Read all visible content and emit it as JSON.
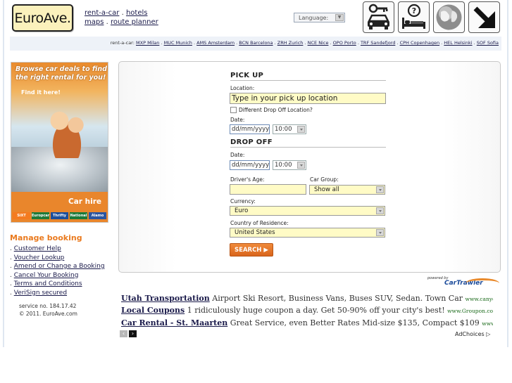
{
  "header": {
    "logo_text": "EuroAve.",
    "links_line1": [
      "rent-a-car",
      "hotels"
    ],
    "links_line2": [
      "maps",
      "route planner"
    ],
    "language_label": "Language:",
    "icons": [
      "car-key-icon",
      "hotel-bed-icon",
      "globe-icon",
      "arrow-down-right-icon"
    ]
  },
  "citybar": {
    "prefix": "rent-a-car:",
    "cities": [
      "MXP Milan",
      "MUC Munich",
      "AMS Amsterdam",
      "BCN Barcelona",
      "ZRH Zurich",
      "NCE Nice",
      "OPO Porto",
      "TRF Sandefjord",
      "CPH Copenhagen",
      "HEL Helsinki",
      "SOF Sofia"
    ]
  },
  "ad": {
    "title_line1": "Browse car deals to find",
    "title_line2": "the right rental for you!",
    "find_it": "Find it here!",
    "car_hire": "Car hire",
    "brands": [
      "SiXT",
      "Europcar",
      "Thrifty",
      "National",
      "Alamo"
    ],
    "brand_colors": [
      "#f47b20",
      "#1f7a3a",
      "#1c4f9c",
      "#1a7a3a",
      "#2a55a0"
    ]
  },
  "manage": {
    "title": "Manage booking",
    "links": [
      "Customer Help",
      "Voucher Lookup",
      "Amend or Change a Booking",
      "Cancel Your Booking",
      "Terms and Conditions",
      "VeriSign secured"
    ]
  },
  "service": {
    "line1": "service no. 184.17.42",
    "line2": "© 2011. EuroAve.com"
  },
  "form": {
    "pickup_title": "PICK UP",
    "location_label": "Location:",
    "location_placeholder": "Type in your pick up location",
    "diff_dropoff_label": "Different Drop Off Location?",
    "date_label": "Date:",
    "pickup_date": "dd/mm/yyyy",
    "pickup_time": "10:00",
    "dropoff_title": "DROP OFF",
    "dropoff_date_label": "Date:",
    "dropoff_date": "dd/mm/yyyy",
    "dropoff_time": "10:00",
    "age_label": "Driver's Age:",
    "car_group_label": "Car Group:",
    "car_group_value": "Show all",
    "currency_label": "Currency:",
    "currency_value": "Euro",
    "residence_label": "Country of Residence:",
    "residence_value": "United States",
    "search_label": "SEARCH"
  },
  "powered": {
    "label": "powered by",
    "brand": "CarTrawler"
  },
  "ads": [
    {
      "title": "Utah Transportation",
      "text": "Airport Ski Resort, Business Vans, Buses SUV, Sedan. Town Car",
      "url": "www.canyontransp..."
    },
    {
      "title": "Local Coupons",
      "text": "1 ridiculously huge coupon a day. Get 50-90% off your city's best!",
      "url": "www.Groupon.com"
    },
    {
      "title": "Car Rental - St. Maarten",
      "text": "Great Service, even Better Rates Mid-size $135, Compact $109",
      "url": "www.carren..."
    }
  ],
  "adchoices": "AdChoices ▷"
}
